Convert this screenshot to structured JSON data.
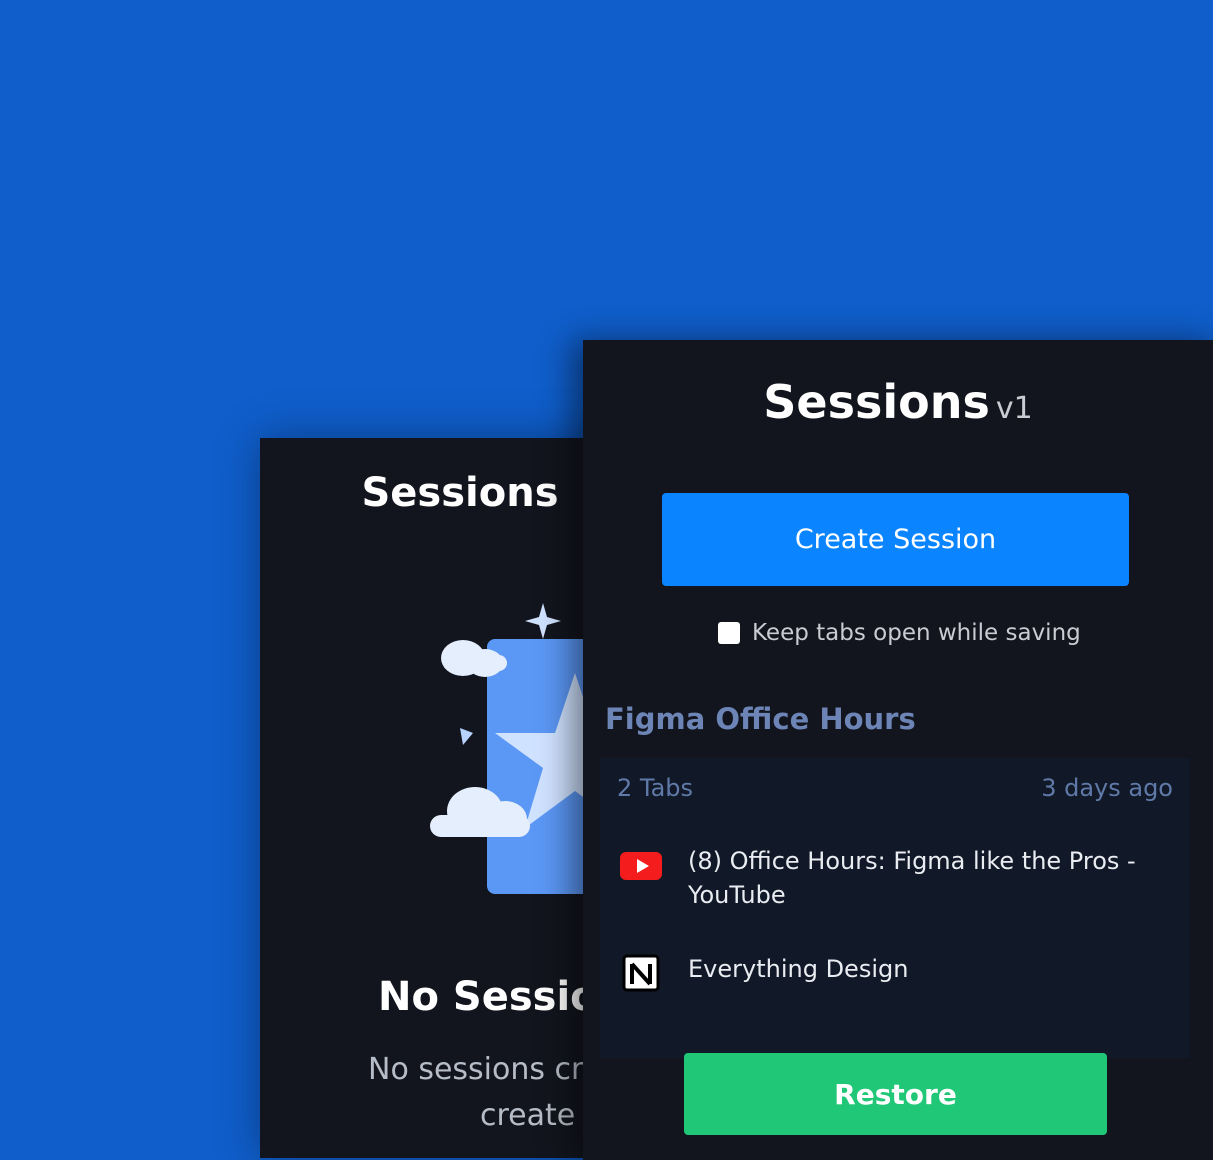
{
  "back_panel": {
    "title": "Sessions",
    "empty_title": "No Sessions",
    "empty_text_line1": "No sessions created yet",
    "empty_text_line2": "create one"
  },
  "front_panel": {
    "title": "Sessions",
    "version": "v1",
    "create_button": "Create Session",
    "keep_tabs_label": "Keep tabs open while saving",
    "group_title": "Figma Office Hours",
    "tabs_count": "2 Tabs",
    "time_ago": "3 days ago",
    "tabs": [
      {
        "title": "(8) Office Hours: Figma like the Pros - YouTube",
        "icon": "youtube-icon"
      },
      {
        "title": "Everything Design",
        "icon": "notion-icon"
      }
    ],
    "restore_button": "Restore"
  },
  "colors": {
    "background": "#0f5ecb",
    "panel": "#12151d",
    "primary": "#0a84ff",
    "success": "#1fc776",
    "muted": "#6d85b6"
  }
}
